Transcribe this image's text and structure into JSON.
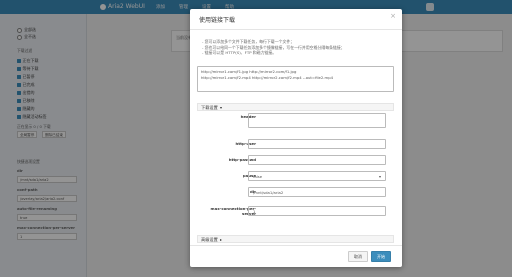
{
  "app": {
    "title": "Aria2 WebUI"
  },
  "topnav": [
    "添加",
    "管理",
    "设置",
    "帮助"
  ],
  "sidebar": {
    "radios": [
      "全部选",
      "全不选"
    ],
    "filter_title": "下载过滤",
    "filters": [
      "正在下载",
      "等待下载",
      "已暂停",
      "已完成",
      "出错的",
      "已移除",
      "隐藏的",
      "隐藏活动标签"
    ],
    "counts": "正在显示 0 / 0 下载",
    "buttons": [
      "全局暂停",
      "删除已结束"
    ],
    "quick_title": "快捷选项设置",
    "fields": [
      {
        "label": "dir",
        "value": "/mnt/sda1/aria2"
      },
      {
        "label": "conf-path",
        "value": "/overlay/aria2/aria2.conf"
      },
      {
        "label": "auto-file-renaming",
        "value": "true"
      },
      {
        "label": "max-connection-per-server",
        "value": "1"
      }
    ]
  },
  "main": {
    "note": "当前没有..."
  },
  "modal": {
    "title": "使用链接下载",
    "close": "×",
    "description": [
      "- 您可以添加多个文件下载任务，每行下载一个文件；",
      "- 您也可以给同一个下载任务添加多个镜像链接，写在一行并用空格分隔每条链接；",
      "- 链接可以是 HTTP(S)、FTP 和磁力链接。"
    ],
    "textarea": [
      "http://mirror1.com/f1.jpg http://mirror2.com/f1.jpg",
      "http://mirror1.com/f2.mp4 http://mirror2.com/f2.mp4 --out=file2.mp4"
    ],
    "download_settings": "下载设置",
    "advanced_settings": "高级设置",
    "fields": [
      {
        "label": "header",
        "value": ""
      },
      {
        "label": "http-user",
        "value": ""
      },
      {
        "label": "http-passwd",
        "value": ""
      },
      {
        "label": "pause",
        "value": "false"
      },
      {
        "label": "dir",
        "value": "/mnt/sda1/aria2"
      },
      {
        "label": "max-connection-per-server",
        "value": "1"
      }
    ],
    "cancel": "取消",
    "start": "开始"
  },
  "colors": {
    "accent": "#3c8dbc",
    "overlay": "rgba(0,0,0,0.42)"
  }
}
